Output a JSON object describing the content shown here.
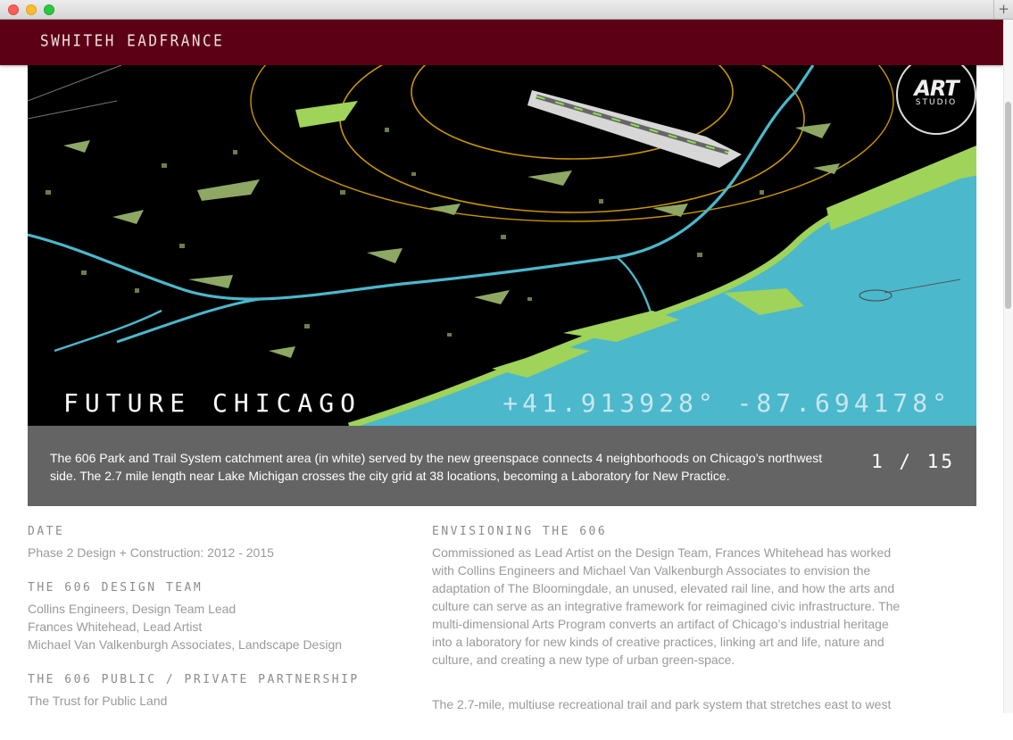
{
  "window": {
    "new_tab_glyph": "+"
  },
  "site": {
    "name": "SWHITEH EADFRANCE"
  },
  "slide": {
    "title": "FUTURE CHICAGO",
    "coords": "+41.913928° -87.694178°",
    "logo_main": "ART",
    "logo_sub": "STUDIO",
    "caption": "The 606 Park and Trail System catchment area (in white) served by the new greenspace connects 4 neighborhoods on Chicago’s northwest side. The 2.7 mile length near Lake Michigan crosses the city grid at 38 locations, becoming a Laboratory for New Practice.",
    "counter": "1 / 15"
  },
  "info": {
    "date_heading": "DATE",
    "date_value": "Phase 2 Design + Construction: 2012 - 2015",
    "team_heading": "THE 606 DESIGN TEAM",
    "team": [
      "Collins Engineers, Design Team Lead",
      "Frances Whitehead, Lead Artist",
      "Michael Van Valkenburgh Associates, Landscape Design"
    ],
    "partnership_heading": "THE 606 PUBLIC / PRIVATE PARTNERSHIP",
    "partners": [
      "The Trust for Public Land"
    ]
  },
  "article": {
    "heading": "ENVISIONING THE 606",
    "paragraphs": [
      "Commissioned as Lead Artist on the Design Team, Frances Whitehead has worked with Collins Engineers and Michael Van Valkenburgh Associates to envision the adaptation of The Bloomingdale, an unused, elevated rail line, and how the arts and culture can serve as an integrative framework for reimagined civic infrastructure. The multi-dimensional Arts Program converts an artifact of Chicago’s industrial heritage into a laboratory for new kinds of creative practices, linking art and life, nature and culture, and creating a new type of urban green-space.",
      "The 2.7-mile, multiuse recreational trail and park system that stretches east to west"
    ]
  },
  "colors": {
    "brand": "#5c0015",
    "caption_bg": "#646464",
    "water": "#4bb8cc",
    "park": "#9fd35a",
    "ring": "#c99500"
  }
}
